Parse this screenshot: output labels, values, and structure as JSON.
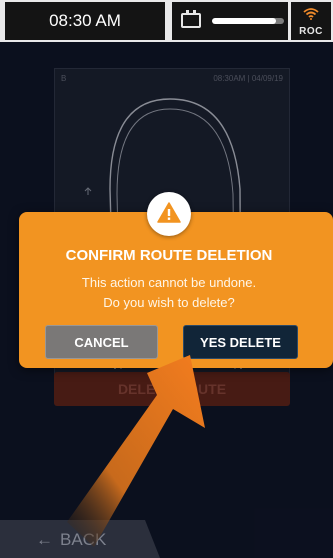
{
  "status_bar": {
    "time": "08:30 AM",
    "battery_icon": "battery-icon",
    "signal_icon": "wifi-icon",
    "network_label": "ROC"
  },
  "route_card": {
    "tag": "B",
    "timestamp": "08:30AM | 04/09/19",
    "delete_button_label": "DELETE ROUTE"
  },
  "dialog": {
    "icon": "warning-icon",
    "title": "CONFIRM ROUTE DELETION",
    "message_line1": "This action cannot be undone.",
    "message_line2": "Do you wish to delete?",
    "cancel_label": "CANCEL",
    "confirm_label": "YES DELETE"
  },
  "nav": {
    "back_label": "BACK",
    "back_icon": "arrow-left-icon"
  },
  "colors": {
    "dialog_bg": "#f29421",
    "confirm_bg": "#112538",
    "cancel_bg": "#7a7877",
    "pointer_arrow": "#f07b1f"
  }
}
